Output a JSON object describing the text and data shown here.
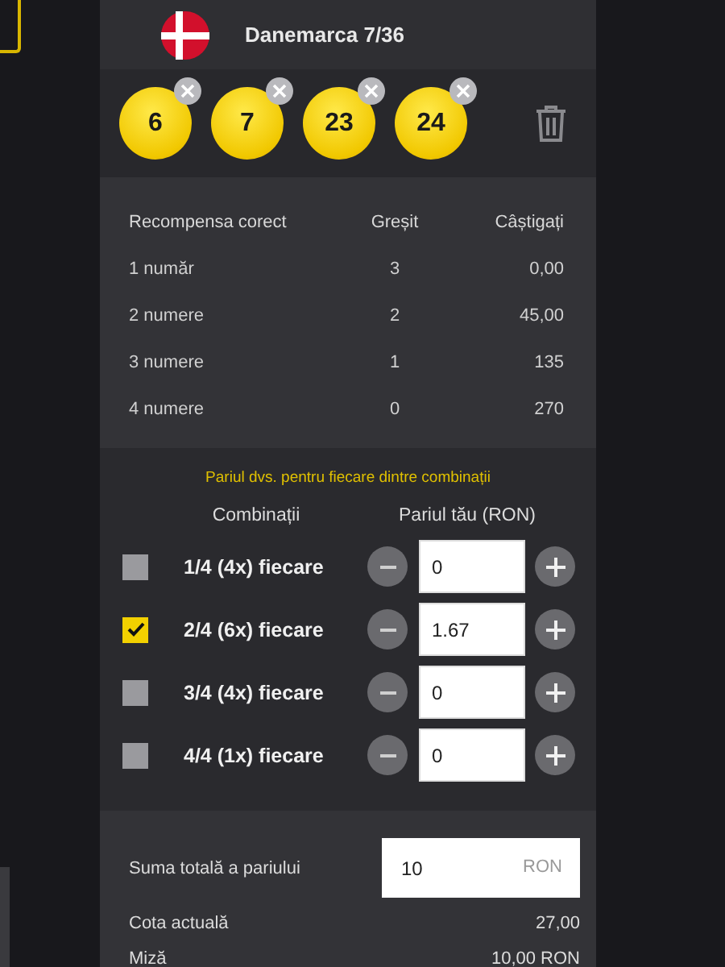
{
  "ticket": {
    "country": "Danemarca 7/36"
  },
  "balls": [
    {
      "number": "6"
    },
    {
      "number": "7"
    },
    {
      "number": "23"
    },
    {
      "number": "24"
    }
  ],
  "prize_table": {
    "columns": [
      "Recompensa corect",
      "Greșit",
      "Câștigați"
    ],
    "rows": [
      [
        "1 număr",
        "3",
        "0,00"
      ],
      [
        "2 numere",
        "2",
        "45,00"
      ],
      [
        "3 numere",
        "1",
        "135"
      ],
      [
        "4 numere",
        "0",
        "270"
      ]
    ]
  },
  "bets": {
    "note": "Pariul dvs. pentru fiecare dintre combinații",
    "columns": [
      "Combinații",
      "Pariul tău (RON)"
    ],
    "combos": [
      {
        "label": "1/4 (4x) fiecare",
        "checked": false,
        "value": "0"
      },
      {
        "label": "2/4 (6x) fiecare",
        "checked": true,
        "value": "1.67"
      },
      {
        "label": "3/4 (4x) fiecare",
        "checked": false,
        "value": "0"
      },
      {
        "label": "4/4 (1x) fiecare",
        "checked": false,
        "value": "0"
      }
    ]
  },
  "summary": {
    "total_label": "Suma totală a pariului",
    "total_value": "10",
    "currency": "RON",
    "rows": [
      {
        "label": "Cota actuală",
        "value": "27,00"
      },
      {
        "label": "Miză",
        "value": "10,00 RON"
      }
    ]
  }
}
